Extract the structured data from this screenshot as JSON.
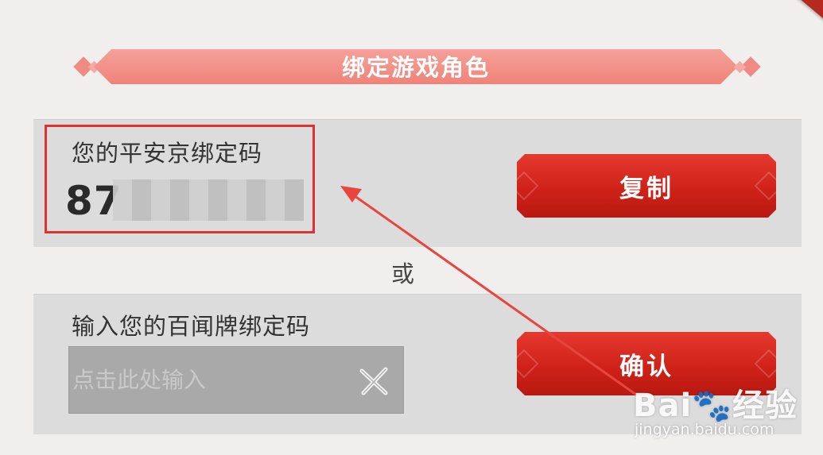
{
  "header": {
    "title": "绑定游戏角色"
  },
  "bind_code_panel": {
    "label": "您的平安京绑定码",
    "code_prefix": "87",
    "copy_button": "复制"
  },
  "separator": {
    "text": "或"
  },
  "input_panel": {
    "label": "输入您的百闻牌绑定码",
    "input_placeholder": "点击此处输入",
    "input_value": "",
    "confirm_button": "确认"
  },
  "watermark": {
    "logo_text": "Bai🐾经验",
    "url": "jingyan.baidu.com"
  },
  "colors": {
    "background": "#f1efee",
    "ribbon": "#ef8379",
    "button_red": "#cf2219",
    "highlight": "#e03131"
  },
  "icons": {
    "clear_input": "close-x-icon",
    "annotation": "arrow-annotation"
  }
}
